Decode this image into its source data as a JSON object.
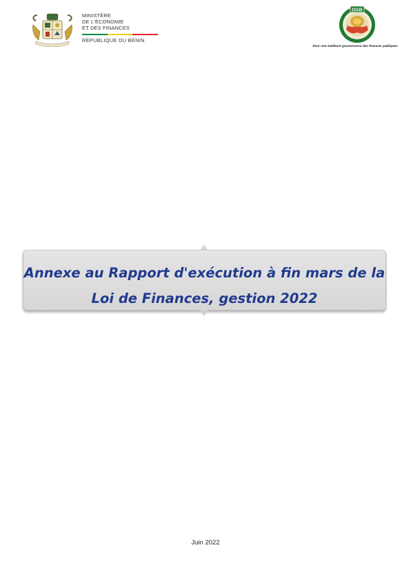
{
  "header": {
    "ministry_lines": [
      "MINISTÈRE",
      "DE L'ÉCONOMIE",
      "ET DES FINANCES"
    ],
    "republic": "RÉPUBLIQUE DU BÉNIN",
    "coat_of_arms_motto": "FRATERNITÉ · JUSTICE · TRAVAIL",
    "flag_colors": [
      "#0c8b3e",
      "#f5d20a",
      "#e2212b"
    ],
    "dgb_logo_text": "DGB",
    "dgb_tagline": "Pour une meilleure gouvernance des finances publiques"
  },
  "title": {
    "line1": "Annexe au Rapport d'exécution à fin mars de la",
    "line2": "Loi de Finances, gestion 2022",
    "color": "#213a8f"
  },
  "footer": {
    "date": "Juin 2022"
  }
}
